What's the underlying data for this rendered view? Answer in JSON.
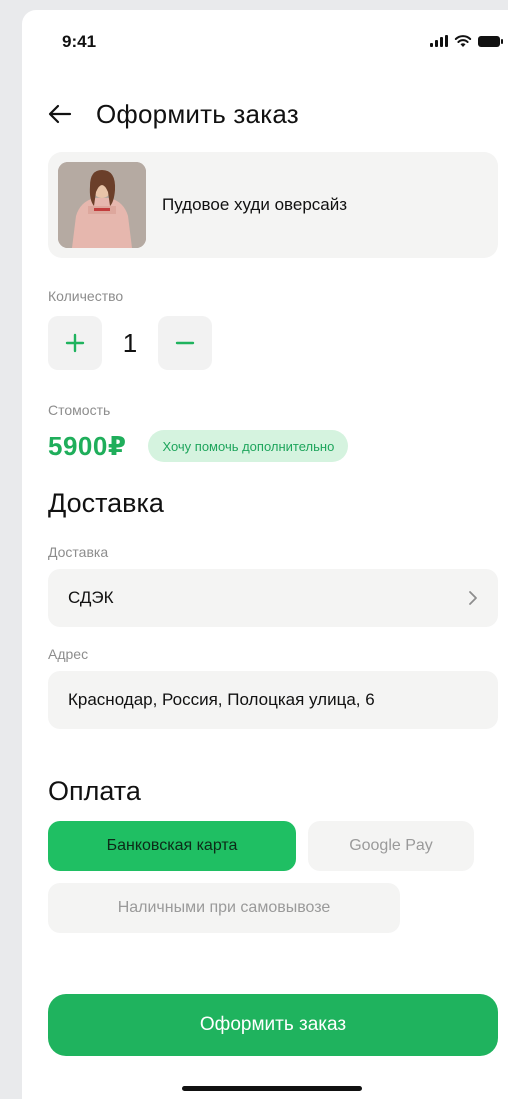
{
  "status_bar": {
    "time": "9:41"
  },
  "header": {
    "title": "Оформить заказ"
  },
  "product": {
    "name": "Пудовое худи оверсайз"
  },
  "quantity": {
    "label": "Количество",
    "value": "1",
    "plus": "+",
    "minus": "−"
  },
  "price": {
    "label": "Стомость",
    "value": "5900₽",
    "help_label": "Хочу помочь дополнительно"
  },
  "delivery": {
    "section_title": "Доставка",
    "method_label": "Доставка",
    "method_value": "СДЭК",
    "address_label": "Адрес",
    "address_value": "Краснодар, Россия, Полоцкая улица, 6"
  },
  "payment": {
    "section_title": "Оплата",
    "options": [
      "Банковская карта",
      "Google Pay",
      "Наличными при самовывозе"
    ],
    "selected": "Банковская карта"
  },
  "submit": {
    "label": "Оформить заказ"
  },
  "colors": {
    "accent": "#1fb35e",
    "accent_light": "#d5f3df",
    "surface": "#f4f4f3"
  }
}
